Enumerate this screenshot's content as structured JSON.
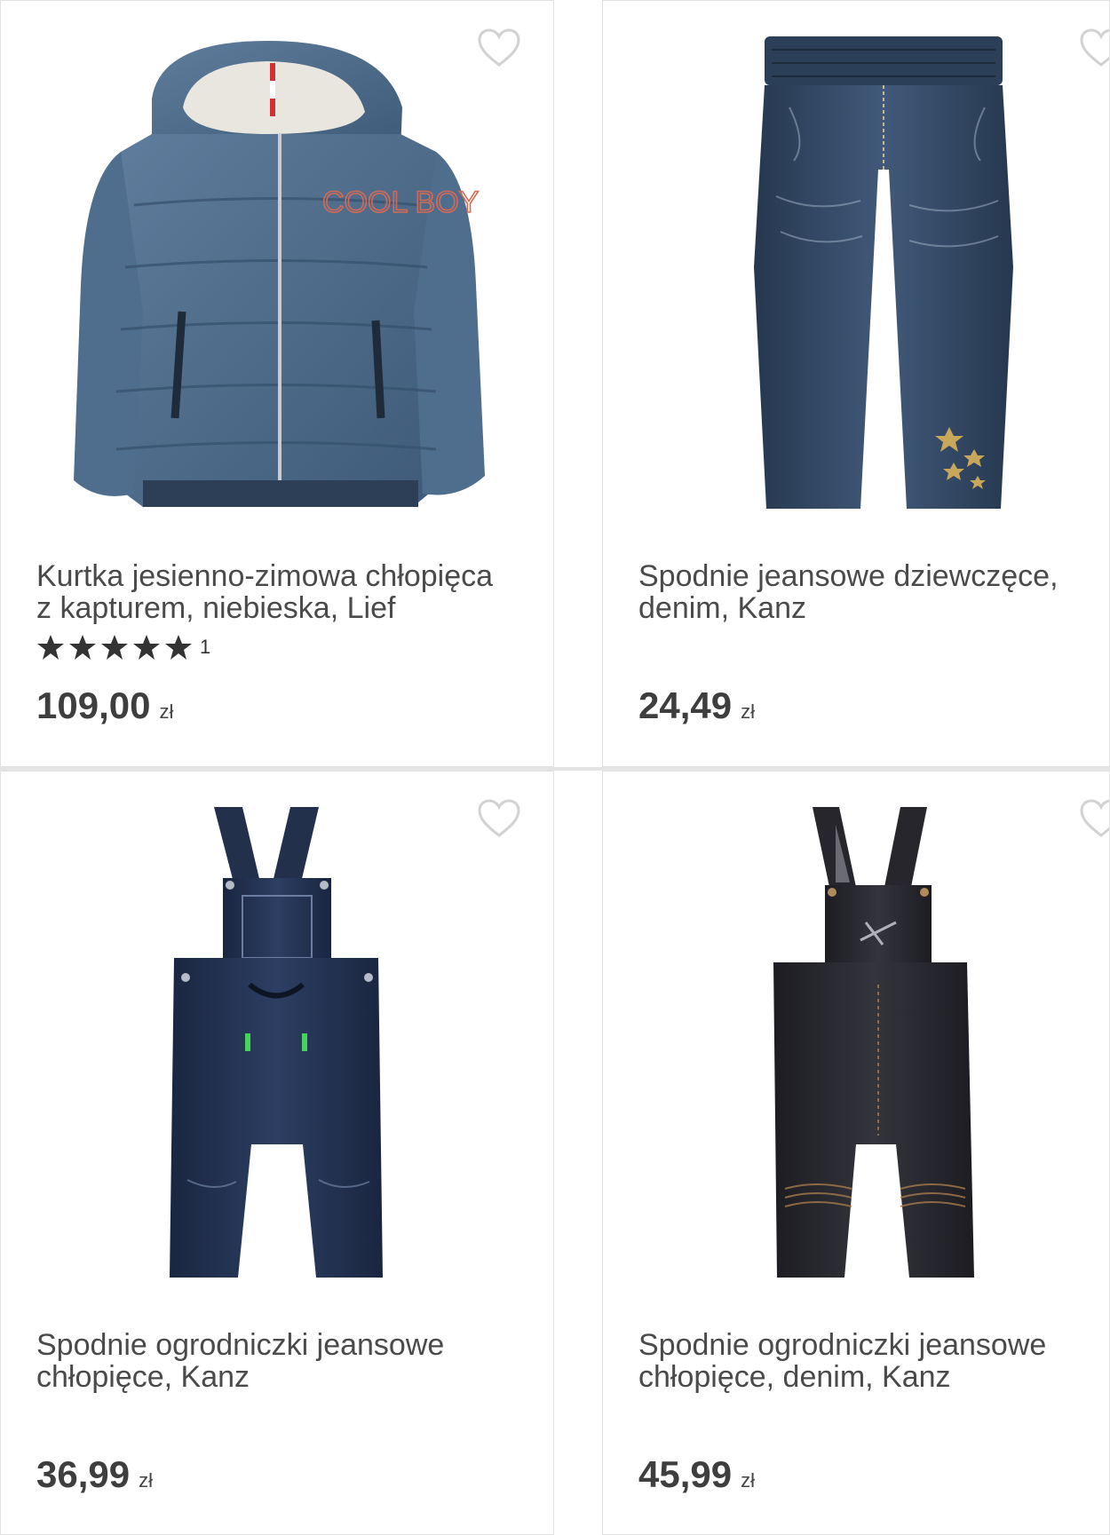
{
  "products": [
    {
      "title_line1": "Kurtka jesienno-zimowa chłopięca",
      "title_line2": "z kapturem, niebieska, Lief",
      "rating_count": "1",
      "rating": 5,
      "price": "109,00",
      "currency": "zł",
      "image_text": "COOL BOY"
    },
    {
      "title_line1": "Spodnie jeansowe dziewczęce,",
      "title_line2": "denim, Kanz",
      "price": "24,49",
      "currency": "zł"
    },
    {
      "title_line1": "Spodnie ogrodniczki jeansowe",
      "title_line2": "chłopięce, Kanz",
      "price": "36,99",
      "currency": "zł"
    },
    {
      "title_line1": "Spodnie ogrodniczki jeansowe",
      "title_line2": "chłopięce, denim, Kanz",
      "price": "45,99",
      "currency": "zł"
    }
  ],
  "colors": {
    "text": "#4a4a4a",
    "price": "#3e3e3e",
    "star": "#333333",
    "heart": "#d2d2d2"
  },
  "icons": {
    "favorite": "heart-outline-icon",
    "rating": "star-icon"
  }
}
